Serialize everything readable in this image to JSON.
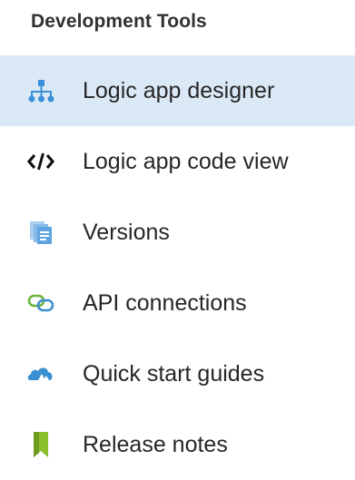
{
  "section": {
    "title": "Development Tools"
  },
  "menu": {
    "items": [
      {
        "label": "Logic app designer",
        "icon": "logic-app-designer-icon",
        "selected": true
      },
      {
        "label": "Logic app code view",
        "icon": "code-view-icon",
        "selected": false
      },
      {
        "label": "Versions",
        "icon": "versions-icon",
        "selected": false
      },
      {
        "label": "API connections",
        "icon": "api-connections-icon",
        "selected": false
      },
      {
        "label": "Quick start guides",
        "icon": "quick-start-icon",
        "selected": false
      },
      {
        "label": "Release notes",
        "icon": "release-notes-icon",
        "selected": false
      }
    ]
  },
  "colors": {
    "selected_background": "#dbe9f7",
    "designer_icon": "#3b8fd6",
    "code_icon": "#111111",
    "versions_icon": "#6aa8e0",
    "connections_icon": "#6bb33a",
    "quickstart_icon": "#3a8fd0",
    "release_notes_icon": "#8cbf2e"
  }
}
